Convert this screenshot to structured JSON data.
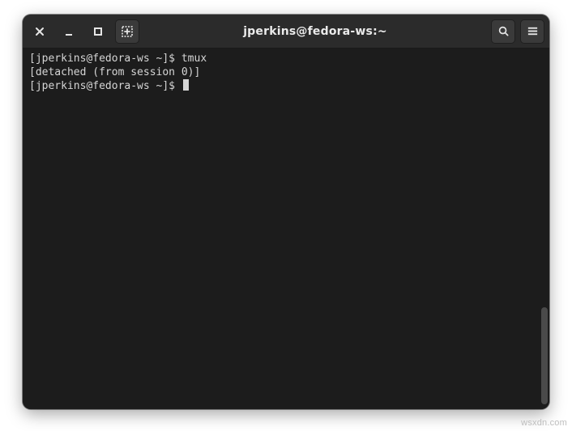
{
  "window": {
    "title": "jperkins@fedora-ws:~"
  },
  "titlebar": {
    "close_label": "Close",
    "minimize_label": "Minimize",
    "maximize_label": "Maximize",
    "new_tab_label": "New Tab",
    "search_label": "Search",
    "menu_label": "Menu"
  },
  "terminal": {
    "lines": [
      {
        "prompt": "[jperkins@fedora-ws ~]$ ",
        "command": "tmux"
      },
      {
        "text": "[detached (from session 0)]"
      },
      {
        "prompt": "[jperkins@fedora-ws ~]$ ",
        "command": "",
        "cursor": true
      }
    ]
  },
  "watermark": "wsxdn.com"
}
